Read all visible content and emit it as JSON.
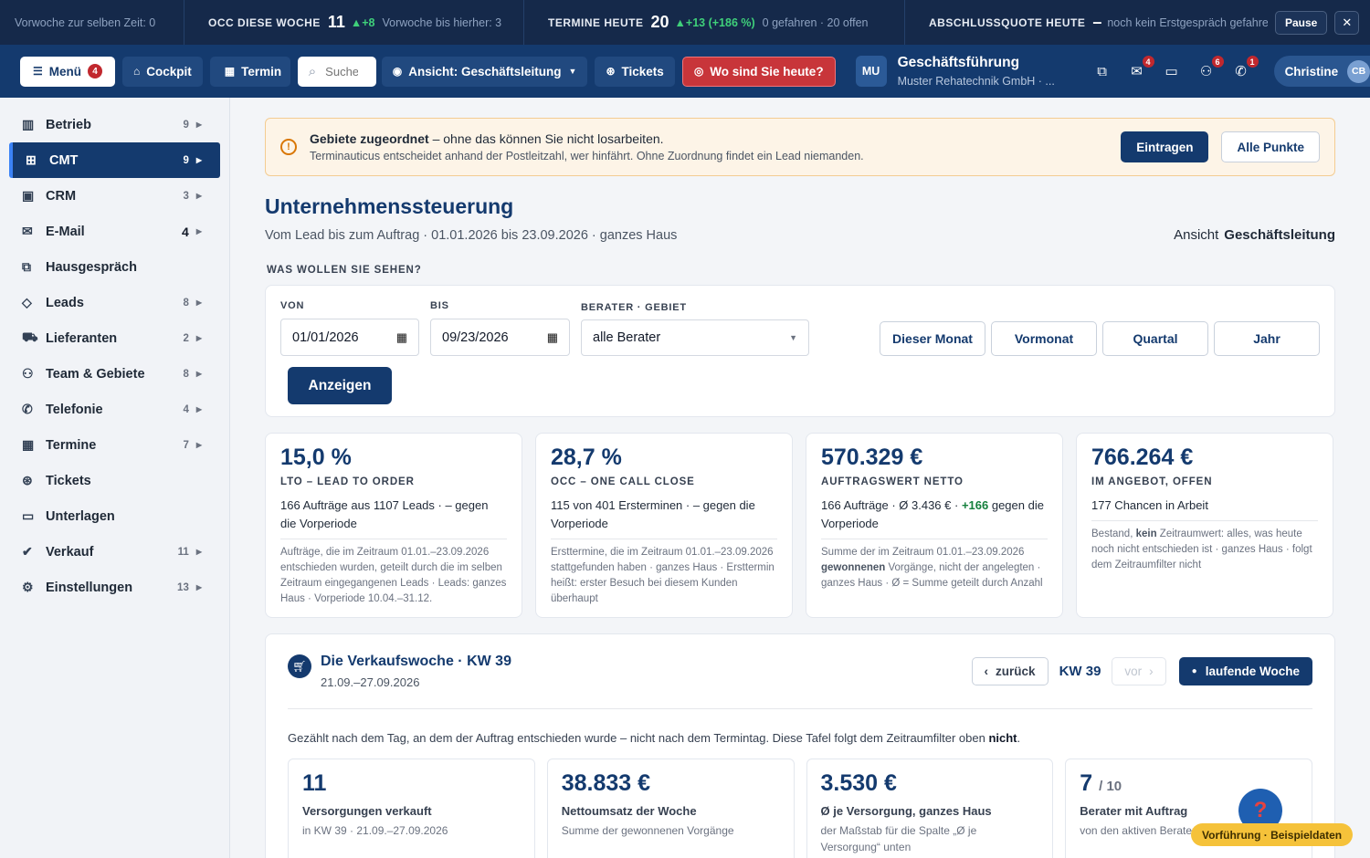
{
  "ticker": {
    "t1_text": "Vorwoche zur selben Zeit: 0",
    "t2_label": "OCC DIESE WOCHE",
    "t2_num": "11",
    "t2_delta": "▲+8",
    "t2_muted": "Vorwoche bis hierher: 3",
    "t3_label": "TERMINE HEUTE",
    "t3_num": "20",
    "t3_delta": "▲+13 (+186 %)",
    "t3_muted": "0 gefahren · 20 offen",
    "t4_label": "ABSCHLUSSQUOTE HEUTE",
    "t4_num": "–",
    "t4_muted": "noch kein Erstgespräch gefahren",
    "pause": "Pause",
    "close": "✕"
  },
  "header": {
    "menu_label": "Menü",
    "menu_badge": "4",
    "cockpit": "Cockpit",
    "termin": "Termin",
    "search_placeholder": "Suche",
    "view_prefix": "Ansicht:",
    "view_value": "Geschäftsleitung",
    "tickets": "Tickets",
    "where": "Wo sind Sie heute?",
    "org_initials": "MU",
    "org_name": "Geschäftsführung",
    "org_sub": "Muster Rehatechnik GmbH · ...",
    "badge_mail": "4",
    "badge_team": "6",
    "badge_phone": "1",
    "user_name": "Christine",
    "user_initials": "CB"
  },
  "sidebar": {
    "items": [
      {
        "label": "Betrieb",
        "count": "9"
      },
      {
        "label": "CMT",
        "count": "9"
      },
      {
        "label": "CRM",
        "count": "3"
      },
      {
        "label": "E-Mail",
        "count": "4"
      },
      {
        "label": "Hausgespräch",
        "count": ""
      },
      {
        "label": "Leads",
        "count": "8"
      },
      {
        "label": "Lieferanten",
        "count": "2"
      },
      {
        "label": "Team & Gebiete",
        "count": "8"
      },
      {
        "label": "Telefonie",
        "count": "4"
      },
      {
        "label": "Termine",
        "count": "7"
      },
      {
        "label": "Tickets",
        "count": ""
      },
      {
        "label": "Unterlagen",
        "count": ""
      },
      {
        "label": "Verkauf",
        "count": "11"
      },
      {
        "label": "Einstellungen",
        "count": "13"
      }
    ]
  },
  "notice": {
    "bold": "Gebiete zugeordnet",
    "rest": " – ohne das können Sie nicht losarbeiten.",
    "line2": "Terminauticus entscheidet anhand der Postleitzahl, wer hinfährt. Ohne Zuordnung findet ein Lead niemanden.",
    "btn1": "Eintragen",
    "btn2": "Alle Punkte"
  },
  "page": {
    "title": "Unternehmenssteuerung",
    "subtitle": "Vom Lead bis zum Auftrag · 01.01.2026 bis 23.09.2026 · ganzes Haus",
    "view_label": "Ansicht",
    "view_value": "Geschäftsleitung",
    "section": "WAS WOLLEN SIE SEHEN?"
  },
  "filter": {
    "von_label": "VON",
    "von_value": "01/01/2026",
    "bis_label": "BIS",
    "bis_value": "09/23/2026",
    "berater_label": "BERATER · GEBIET",
    "berater_value": "alle Berater",
    "presets": [
      "Dieser Monat",
      "Vormonat",
      "Quartal",
      "Jahr"
    ],
    "show": "Anzeigen"
  },
  "kpis": [
    {
      "value": "15,0 %",
      "key": "LTO – LEAD TO ORDER",
      "desc": "166 Aufträge aus 1107 Leads · – gegen die Vorperiode",
      "note": "Aufträge, die im Zeitraum 01.01.–23.09.2026 entschieden wurden, geteilt durch die im selben Zeitraum eingegangenen Leads · Leads: ganzes Haus · Vorperiode 10.04.–31.12."
    },
    {
      "value": "28,7 %",
      "key": "OCC – ONE CALL CLOSE",
      "desc": "115 von 401 Ersterminen · – gegen die Vorperiode",
      "note": "Ersttermine, die im Zeitraum 01.01.–23.09.2026 stattgefunden haben · ganzes Haus · Ersttermin heißt: erster Besuch bei diesem Kunden überhaupt"
    },
    {
      "value": "570.329 €",
      "key": "AUFTRAGSWERT NETTO",
      "desc_a": "166 Aufträge · Ø 3.436 € · ",
      "desc_g": "+166",
      "desc_b": " gegen die Vorperiode",
      "note_a": "Summe der im Zeitraum 01.01.–23.09.2026 ",
      "note_b": "gewonnenen",
      "note_c": " Vorgänge, nicht der angelegten · ganzes Haus · Ø = Summe geteilt durch Anzahl"
    },
    {
      "value": "766.264 €",
      "key": "IM ANGEBOT, OFFEN",
      "desc": "177 Chancen in Arbeit",
      "note_a": "Bestand, ",
      "note_b": "kein",
      "note_c": " Zeitraumwert: alles, was heute noch nicht entschieden ist · ganzes Haus · folgt dem Zeitraumfilter nicht"
    }
  ],
  "week": {
    "title": "Die Verkaufswoche · KW 39",
    "date": "21.09.–27.09.2026",
    "back": "zurück",
    "kw": "KW 39",
    "fwd": "vor",
    "current": "laufende Woche",
    "note_a": "Gezählt nach dem Tag, an dem der Auftrag entschieden wurde – nicht nach dem Termintag. Diese Tafel folgt dem Zeitraumfilter oben ",
    "note_b": "nicht",
    "note_c": ".",
    "cards": [
      {
        "value": "11",
        "label": "Versorgungen verkauft",
        "sub": "in KW 39 · 21.09.–27.09.2026"
      },
      {
        "value": "38.833 €",
        "label": "Nettoumsatz der Woche",
        "sub": "Summe der gewonnenen Vorgänge"
      },
      {
        "value": "3.530 €",
        "label": "Ø je Versorgung, ganzes Haus",
        "sub": "der Maßstab für die Spalte „Ø je Versorgung“ unten"
      },
      {
        "value": "7",
        "value_suffix": "/ 10",
        "label": "Berater mit Auftrag",
        "sub": "von den aktiven Beratern"
      }
    ]
  },
  "footer": {
    "help": "?",
    "demo": "Vorführung · Beispieldaten"
  }
}
